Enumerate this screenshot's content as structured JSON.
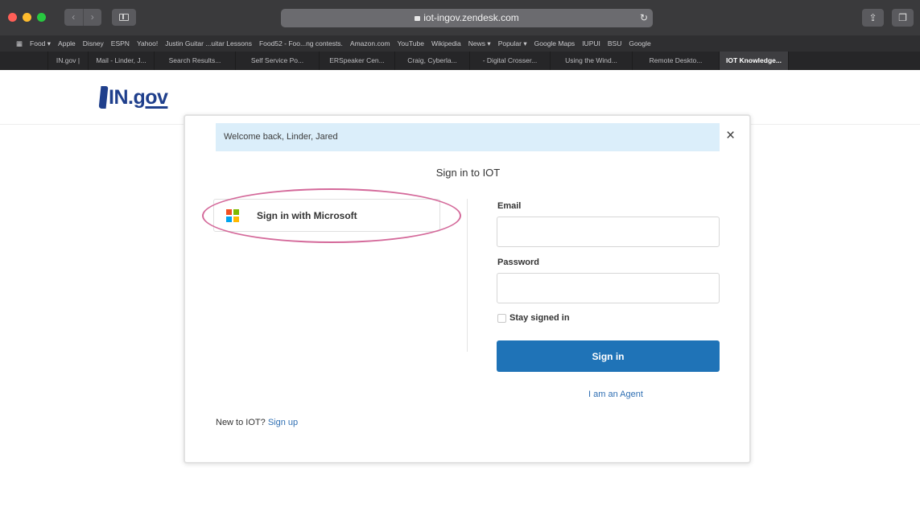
{
  "browser": {
    "url": "iot-ingov.zendesk.com",
    "bookmarks": [
      "Food ▾",
      "Apple",
      "Disney",
      "ESPN",
      "Yahoo!",
      "Justin Guitar ...uitar Lessons",
      "Food52 - Foo...ng contests.",
      "Amazon.com",
      "YouTube",
      "Wikipedia",
      "News ▾",
      "Popular ▾",
      "Google Maps",
      "IUPUI",
      "BSU",
      "Google"
    ],
    "tabs": [
      {
        "label": "IN.gov |"
      },
      {
        "label": "Mail - Linder, J..."
      },
      {
        "label": "Search Results..."
      },
      {
        "label": "Self Service Po..."
      },
      {
        "label": "ERSpeaker Cen..."
      },
      {
        "label": "Craig, Cyberla..."
      },
      {
        "label": "- Digital Crosser..."
      },
      {
        "label": "Using the Wind..."
      },
      {
        "label": "Remote Deskto..."
      },
      {
        "label": "IOT Knowledge..."
      }
    ]
  },
  "header": {
    "logo_text": "IN.",
    "logo_gov": "gov"
  },
  "modal": {
    "welcome_text": "Welcome back, Linder, Jared",
    "close_glyph": "×",
    "title": "Sign in to IOT",
    "microsoft_button_label": "Sign in with Microsoft",
    "email_label": "Email",
    "email_value": "",
    "password_label": "Password",
    "password_value": "",
    "stay_signed_in_label": "Stay signed in",
    "sign_in_label": "Sign in",
    "agent_link_label": "I am an Agent",
    "new_to_text": "New to IOT?",
    "sign_up_label": "Sign up"
  },
  "colors": {
    "brand_blue": "#1f3f8c",
    "primary_button": "#1f73b7",
    "welcome_bg": "#dbeefa",
    "highlight_ring": "#d4699a",
    "ms_red": "#f25022",
    "ms_green": "#7fba00",
    "ms_blue": "#00a4ef",
    "ms_yellow": "#ffb900"
  }
}
